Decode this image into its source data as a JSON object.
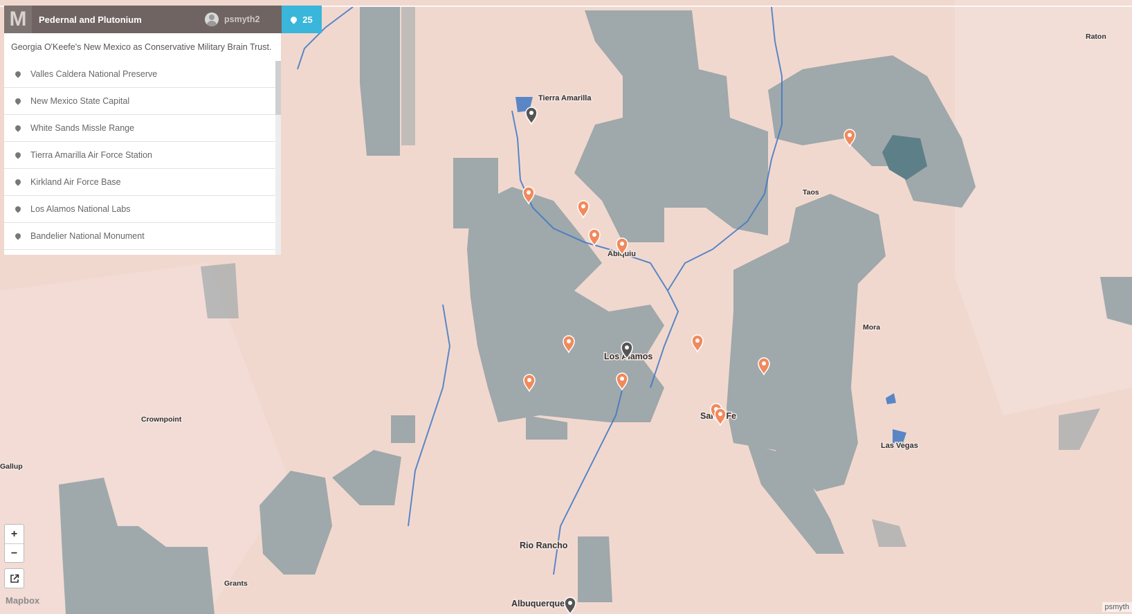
{
  "header": {
    "logo": "M",
    "title": "Pedernal and Plutonium",
    "user": "psmyth2",
    "marker_count": "25"
  },
  "description": "Georgia O'Keefe's New Mexico as Conservative Military Brain Trust.",
  "places": [
    {
      "label": "Valles Caldera National Preserve"
    },
    {
      "label": "New Mexico State Capital"
    },
    {
      "label": "White Sands Missle Range"
    },
    {
      "label": "Tierra Amarilla Air Force Station"
    },
    {
      "label": "Kirkland Air Force Base"
    },
    {
      "label": "Los Alamos National Labs"
    },
    {
      "label": "Bandelier National Monument"
    }
  ],
  "controls": {
    "zoom_in": "+",
    "zoom_out": "−"
  },
  "map_labels": {
    "tierra_amarilla": "Tierra Amarilla",
    "abiquiu": "Abiquiu",
    "los_alamos": "Los Alamos",
    "santa_fe": "Santa Fe",
    "taos": "Taos",
    "mora": "Mora",
    "las_vegas": "Las Vegas",
    "raton": "Raton",
    "crownpoint": "Crownpoint",
    "gallup": "Gallup",
    "grants": "Grants",
    "rio_rancho": "Rio Rancho",
    "albuquerque": "Albuquerque"
  },
  "attribution": {
    "brand": "Mapbox",
    "credit": "psmyth"
  },
  "colors": {
    "marker_orange": "#f08a5d",
    "marker_dark": "#555555",
    "accent": "#39b6da",
    "land": "#f1d8cf",
    "public_land": "#9aa6a8",
    "water": "#3f78c4"
  }
}
